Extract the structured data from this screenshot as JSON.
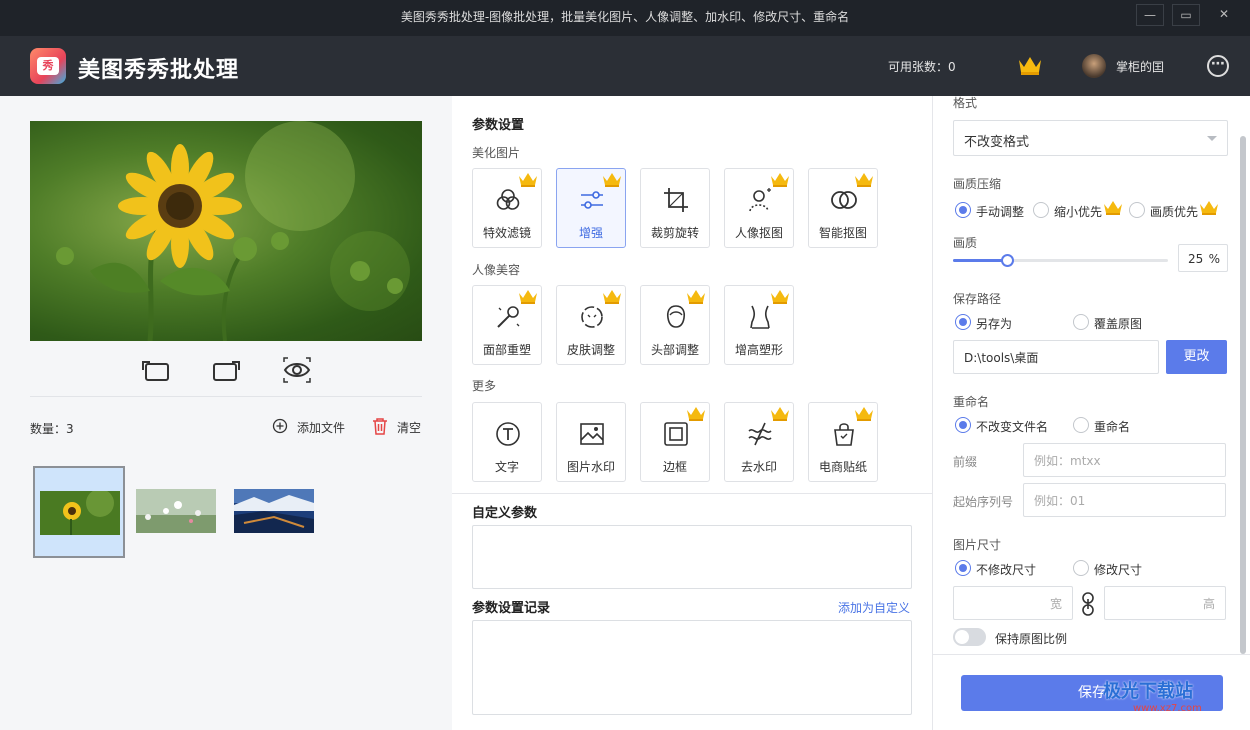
{
  "window": {
    "title": "美图秀秀批处理-图像批处理，批量美化图片、人像调整、加水印、修改尺寸、重命名",
    "minimize": "—",
    "maximize": "▭",
    "close": "✕"
  },
  "header": {
    "app_name": "美图秀秀批处理",
    "logo_text": "秀",
    "quota_label": "可用张数：0",
    "username": "掌柜的囯",
    "more": "⋯"
  },
  "left": {
    "count_label": "数量：3",
    "add_file": "添加文件",
    "clear": "清空"
  },
  "params": {
    "title": "参数设置",
    "groups": [
      {
        "name": "美化图片",
        "tools": [
          {
            "label": "特效滤镜",
            "vip": true,
            "icon": "filter-icon"
          },
          {
            "label": "增强",
            "vip": true,
            "icon": "enhance-icon",
            "active": true
          },
          {
            "label": "裁剪旋转",
            "vip": false,
            "icon": "crop-icon"
          },
          {
            "label": "人像抠图",
            "vip": true,
            "icon": "portrait-cutout-icon"
          },
          {
            "label": "智能抠图",
            "vip": true,
            "icon": "smart-cutout-icon"
          }
        ]
      },
      {
        "name": "人像美容",
        "tools": [
          {
            "label": "面部重塑",
            "vip": true,
            "icon": "face-reshape-icon"
          },
          {
            "label": "皮肤调整",
            "vip": true,
            "icon": "skin-icon"
          },
          {
            "label": "头部调整",
            "vip": true,
            "icon": "head-icon"
          },
          {
            "label": "增高塑形",
            "vip": true,
            "icon": "body-shape-icon"
          }
        ]
      },
      {
        "name": "更多",
        "tools": [
          {
            "label": "文字",
            "vip": false,
            "icon": "text-icon"
          },
          {
            "label": "图片水印",
            "vip": false,
            "icon": "image-watermark-icon"
          },
          {
            "label": "边框",
            "vip": true,
            "icon": "border-icon"
          },
          {
            "label": "去水印",
            "vip": true,
            "icon": "remove-watermark-icon"
          },
          {
            "label": "电商贴纸",
            "vip": true,
            "icon": "sticker-icon"
          }
        ]
      }
    ],
    "custom_title": "自定义参数",
    "history_title": "参数设置记录",
    "add_custom": "添加为自定义"
  },
  "settings": {
    "format_label": "格式",
    "format_value": "不改变格式",
    "compress_label": "画质压缩",
    "compress_options": [
      "手动调整",
      "缩小优先",
      "画质优先"
    ],
    "quality_label": "画质",
    "quality_value": "25",
    "quality_unit": "%",
    "quality_fraction": 0.25,
    "path_label": "保存路径",
    "path_options": [
      "另存为",
      "覆盖原图"
    ],
    "path_value": "D:\\tools\\桌面",
    "change_button": "更改",
    "rename_label": "重命名",
    "rename_options": [
      "不改变文件名",
      "重命名"
    ],
    "prefix_label": "前缀",
    "prefix_placeholder": "例如：mtxx",
    "start_label": "起始序列号",
    "start_placeholder": "例如：01",
    "size_label": "图片尺寸",
    "size_options": [
      "不修改尺寸",
      "修改尺寸"
    ],
    "width_suffix": "宽",
    "height_suffix": "高",
    "keep_ratio": "保持原图比例",
    "save_button": "保存"
  },
  "watermark": {
    "brand": "极光下载站",
    "url": "www.xz7.com"
  },
  "colors": {
    "accent": "#5b7bea",
    "header_bg": "#2b2f36",
    "titlebar_bg": "#1f2329",
    "crown": "#f5b90f"
  }
}
